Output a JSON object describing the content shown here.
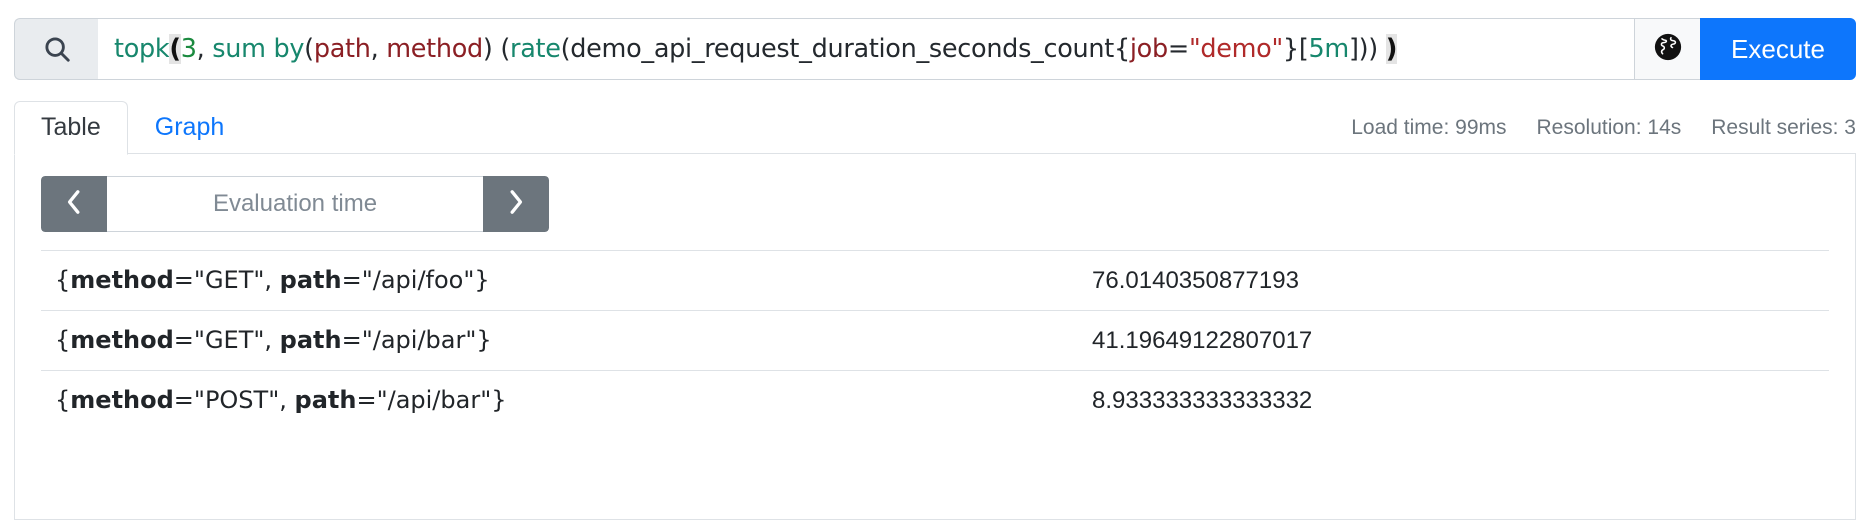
{
  "query_bar": {
    "search_icon": "search-icon",
    "expression_plain": "topk(3, sum by(path, method) (rate(demo_api_request_duration_seconds_count{job=\"demo\"}[5m])))",
    "expression_tokens": [
      {
        "text": "topk",
        "type": "function"
      },
      {
        "text": "(",
        "type": "bracket-highlight"
      },
      {
        "text": "3",
        "type": "number"
      },
      {
        "text": ", ",
        "type": "plain"
      },
      {
        "text": "sum by",
        "type": "function"
      },
      {
        "text": "(",
        "type": "plain"
      },
      {
        "text": "path",
        "type": "label"
      },
      {
        "text": ", ",
        "type": "plain"
      },
      {
        "text": "method",
        "type": "label"
      },
      {
        "text": ") (",
        "type": "plain"
      },
      {
        "text": "rate",
        "type": "function"
      },
      {
        "text": "(demo_api_request_duration_seconds_count{",
        "type": "plain"
      },
      {
        "text": "job",
        "type": "label"
      },
      {
        "text": "=",
        "type": "plain"
      },
      {
        "text": "\"demo\"",
        "type": "string"
      },
      {
        "text": "}[",
        "type": "plain"
      },
      {
        "text": "5m",
        "type": "duration"
      },
      {
        "text": "])) ",
        "type": "plain"
      },
      {
        "text": ")",
        "type": "bracket-highlight"
      }
    ],
    "metrics_explorer_icon": "globe-icon",
    "execute_label": "Execute",
    "execute_color": "#0d76fc"
  },
  "tabs": [
    {
      "label": "Table",
      "active": true
    },
    {
      "label": "Graph",
      "active": false
    }
  ],
  "stats": {
    "load_time": "Load time: 99ms",
    "resolution": "Resolution: 14s",
    "result_series": "Result series: 3"
  },
  "evaluation_time": {
    "prev_icon": "chevron-left-icon",
    "next_icon": "chevron-right-icon",
    "value": "",
    "placeholder": "Evaluation time"
  },
  "table": {
    "rows": [
      {
        "metric_open": "{",
        "labels": [
          {
            "name": "method",
            "op": "=",
            "value": "\"GET\""
          },
          {
            "name": "path",
            "op": "=",
            "value": "\"/api/foo\""
          }
        ],
        "metric_close": "}",
        "value": "76.0140350877193"
      },
      {
        "metric_open": "{",
        "labels": [
          {
            "name": "method",
            "op": "=",
            "value": "\"GET\""
          },
          {
            "name": "path",
            "op": "=",
            "value": "\"/api/bar\""
          }
        ],
        "metric_close": "}",
        "value": "41.19649122807017"
      },
      {
        "metric_open": "{",
        "labels": [
          {
            "name": "method",
            "op": "=",
            "value": "\"POST\""
          },
          {
            "name": "path",
            "op": "=",
            "value": "\"/api/bar\""
          }
        ],
        "metric_close": "}",
        "value": "8.933333333333332"
      }
    ]
  }
}
